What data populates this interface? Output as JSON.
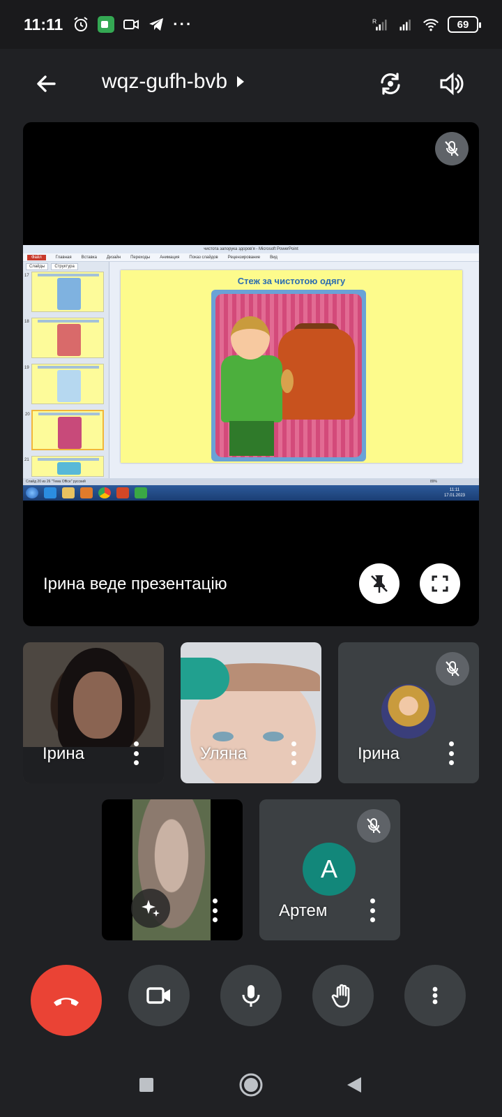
{
  "status_bar": {
    "time": "11:11",
    "battery": "69",
    "signal_label": "R",
    "icons": [
      "alarm-icon",
      "meet-icon",
      "video-icon",
      "telegram-icon",
      "more-dots"
    ]
  },
  "header": {
    "meeting_code": "wqz-gufh-bvb"
  },
  "presentation": {
    "presenter_label": "Ірина веде презентацію",
    "screen": {
      "window_title": "чистота запорука здоров'я - Microsoft PowerPoint",
      "file_tab": "Файл",
      "ribbon_tabs": [
        "Главная",
        "Вставка",
        "Дизайн",
        "Переходы",
        "Анимация",
        "Показ слайдов",
        "Рецензирование",
        "Вид"
      ],
      "side_tabs": [
        "Слайды",
        "Структура"
      ],
      "thumbnails": [
        {
          "num": "17",
          "color": "#7fb2e0"
        },
        {
          "num": "18",
          "color": "#d96a6a"
        },
        {
          "num": "19",
          "color": "#b6d8f0"
        },
        {
          "num": "20",
          "color": "#c84a7a"
        },
        {
          "num": "21",
          "color": "#58b8d8"
        }
      ],
      "slide_title": "Стеж за чистотою одягу",
      "status_text": "Слайд 20 из 26   \"Тема Office\"   русский",
      "zoom": "89%",
      "taskbar_time": "11:11",
      "taskbar_date": "17.01.2023"
    }
  },
  "participants": [
    {
      "name": "Ірина",
      "type": "video",
      "muted": false
    },
    {
      "name": "Уляна",
      "type": "video",
      "muted": false
    },
    {
      "name": "Ірина",
      "type": "photo",
      "muted": true
    },
    {
      "name": "",
      "type": "self-video",
      "muted": false
    },
    {
      "name": "Артем",
      "type": "letter",
      "initial": "A",
      "muted": true
    }
  ],
  "controls": [
    "end-call",
    "camera",
    "microphone",
    "raise-hand",
    "more-options"
  ],
  "colors": {
    "background": "#202124",
    "tile": "#3c4043",
    "end_call": "#ea4335",
    "avatar_teal": "#12877a"
  }
}
